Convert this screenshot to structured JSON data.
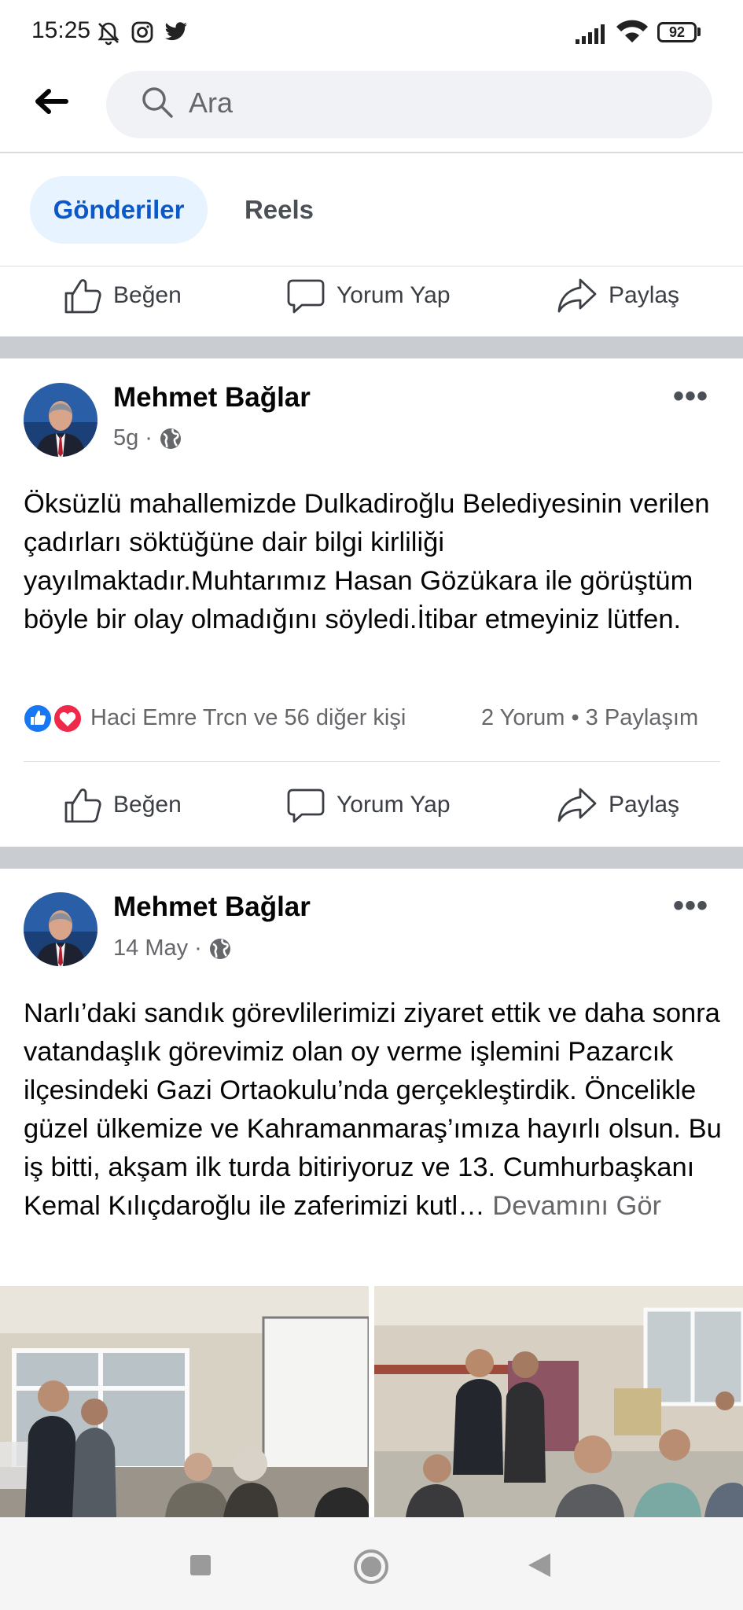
{
  "status_bar": {
    "time": "15:25",
    "battery": "92",
    "icons": [
      "bell-off-icon",
      "instagram-icon",
      "twitter-icon",
      "signal-icon",
      "wifi-icon",
      "battery-icon"
    ]
  },
  "search": {
    "placeholder": "Ara"
  },
  "tabs": [
    {
      "label": "Gönderiler",
      "active": true
    },
    {
      "label": "Reels",
      "active": false
    }
  ],
  "actions": {
    "like": "Beğen",
    "comment": "Yorum Yap",
    "share": "Paylaş"
  },
  "posts": [
    {
      "author": "Mehmet Bağlar",
      "time": "5g",
      "text": "Öksüzlü mahallemizde Dulkadiroğlu Belediyesinin verilen çadırları söktüğüne dair bilgi kirliliği yayılmaktadır.Muhtarımız Hasan Gözükara ile görüştüm böyle bir olay olmadığını söyledi.İtibar etmeyiniz lütfen.",
      "reactions": "Haci Emre Trcn ve 56 diğer kişi",
      "counts": "2 Yorum • 3 Paylaşım"
    },
    {
      "author": "Mehmet Bağlar",
      "time": "14 May",
      "text": "Narlı’daki sandık görevlilerimizi ziyaret ettik ve daha sonra vatandaşlık görevimiz olan oy verme işlemini Pazarcık ilçesindeki Gazi Ortaokulu’nda gerçekleştirdik. Öncelikle güzel ülkemize ve Kahramanmaraş’ımıza hayırlı olsun. Bu iş bitti, akşam ilk turda bitiriyoruz ve 13. Cumhurbaşkanı Kemal Kılıçdaroğlu ile zaferimizi kutl…",
      "see_more": " Devamını Gör"
    }
  ],
  "colors": {
    "accent": "#0a58ca",
    "tab_bg": "#e7f3ff",
    "separator": "#c9ccd1"
  }
}
